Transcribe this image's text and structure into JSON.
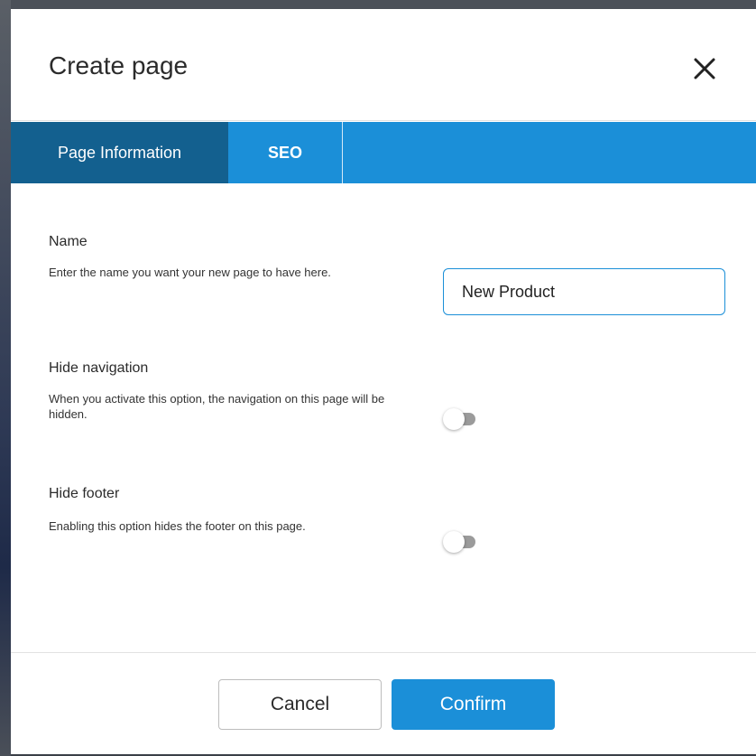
{
  "dialog": {
    "title": "Create page",
    "close_icon": "close-icon"
  },
  "tabs": [
    {
      "label": "Page Information",
      "active": true
    },
    {
      "label": "SEO",
      "active": false
    }
  ],
  "fields": {
    "name": {
      "title": "Name",
      "description": "Enter the name you want your new page to have here.",
      "value": "New Product"
    },
    "hide_navigation": {
      "title": "Hide navigation",
      "description": "When you activate this option, the navigation on this page will be hidden.",
      "enabled": false
    },
    "hide_footer": {
      "title": "Hide footer",
      "description": "Enabling this option hides the footer on this page.",
      "enabled": false
    }
  },
  "actions": {
    "cancel_label": "Cancel",
    "confirm_label": "Confirm"
  },
  "colors": {
    "accent": "#1b8fd8",
    "tab_active": "#13608f",
    "toggle_off": "#9b9b9b"
  }
}
